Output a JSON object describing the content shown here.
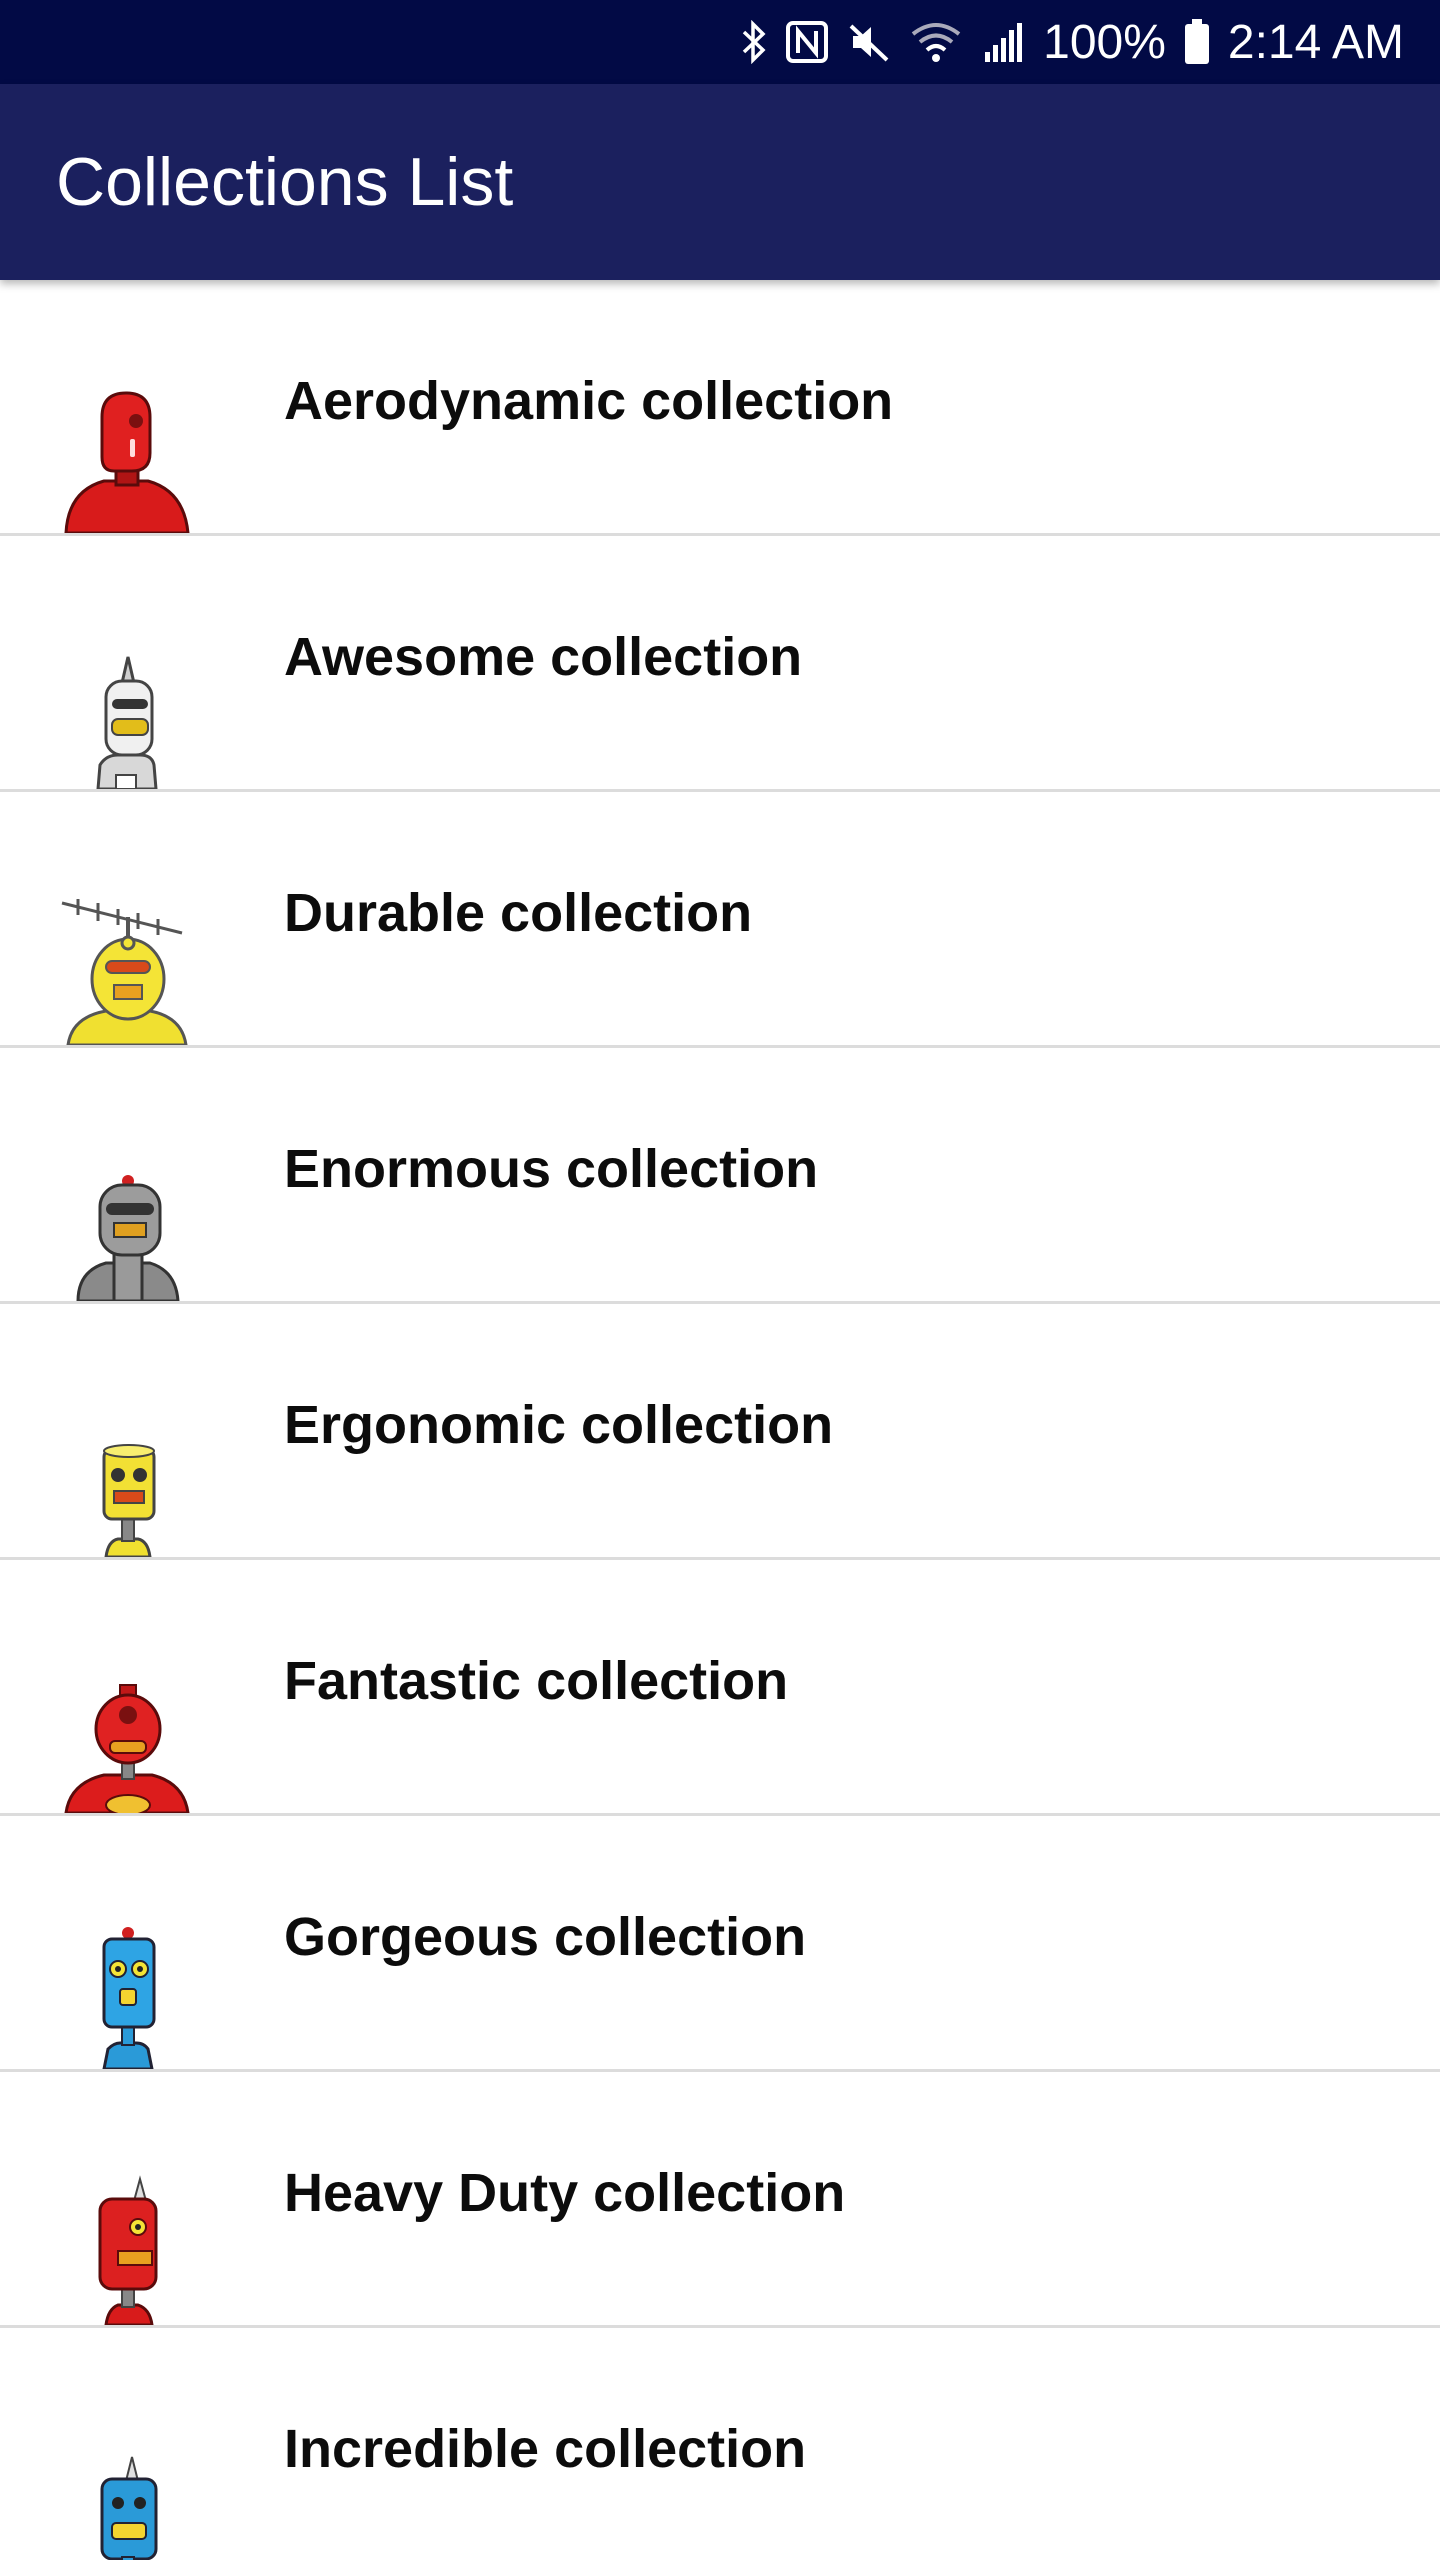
{
  "status_bar": {
    "battery": "100%",
    "time": "2:14 AM",
    "icons": [
      "bluetooth-icon",
      "nfc-icon",
      "mute-icon",
      "wifi-icon",
      "signal-icon",
      "battery-icon"
    ]
  },
  "app_bar": {
    "title": "Collections List"
  },
  "colors": {
    "status_bar_bg": "#020a45",
    "app_bar_bg": "#1b205e",
    "divider": "#dcdcdc"
  },
  "collections": [
    {
      "label": "Aerodynamic collection",
      "icon": "red-robot-icon"
    },
    {
      "label": "Awesome collection",
      "icon": "white-robot-icon"
    },
    {
      "label": "Durable collection",
      "icon": "yellow-antenna-robot-icon"
    },
    {
      "label": "Enormous collection",
      "icon": "gray-robot-icon"
    },
    {
      "label": "Ergonomic collection",
      "icon": "yellow-robot-icon"
    },
    {
      "label": "Fantastic collection",
      "icon": "red-round-robot-icon"
    },
    {
      "label": "Gorgeous collection",
      "icon": "blue-robot-icon"
    },
    {
      "label": "Heavy Duty collection",
      "icon": "red-horn-robot-icon"
    },
    {
      "label": "Incredible collection",
      "icon": "blue-horn-robot-icon"
    }
  ]
}
